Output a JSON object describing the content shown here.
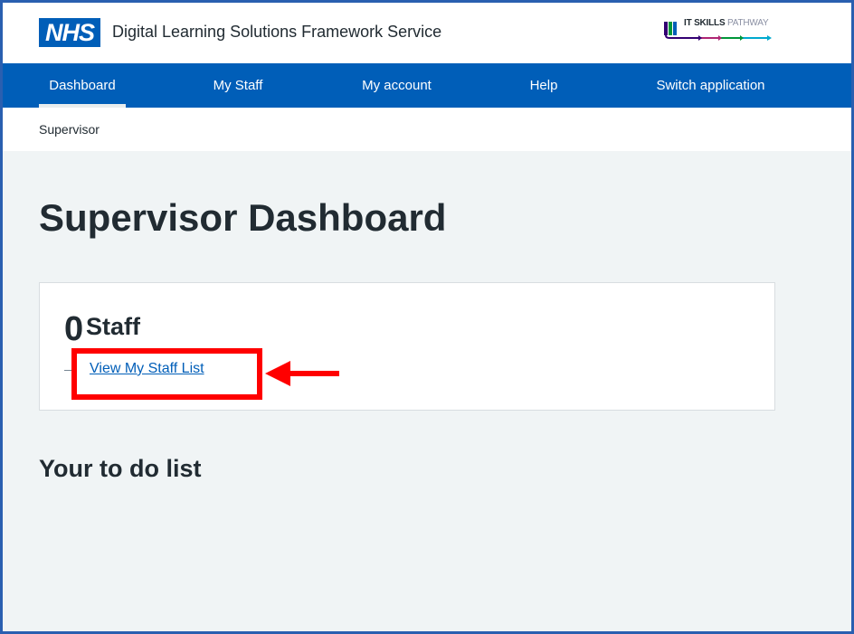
{
  "header": {
    "nhs_logo_text": "NHS",
    "service_name": "Digital Learning Solutions Framework Service",
    "partner_logo": {
      "bold": "IT SKILLS",
      "light": "PATHWAY"
    }
  },
  "nav": {
    "items": [
      {
        "label": "Dashboard",
        "active": true
      },
      {
        "label": "My Staff",
        "active": false
      },
      {
        "label": "My account",
        "active": false
      },
      {
        "label": "Help",
        "active": false
      },
      {
        "label": "Switch application",
        "active": false
      }
    ]
  },
  "breadcrumb": "Supervisor",
  "page_title": "Supervisor Dashboard",
  "staff_card": {
    "count": "0",
    "label": "Staff",
    "link_text": "View My Staff List"
  },
  "todo_heading": "Your to do list",
  "colors": {
    "nhs_blue": "#005eb8",
    "page_background": "#f0f4f5",
    "annotation_red": "#ff0000",
    "frame_border": "#2a5fb0"
  }
}
